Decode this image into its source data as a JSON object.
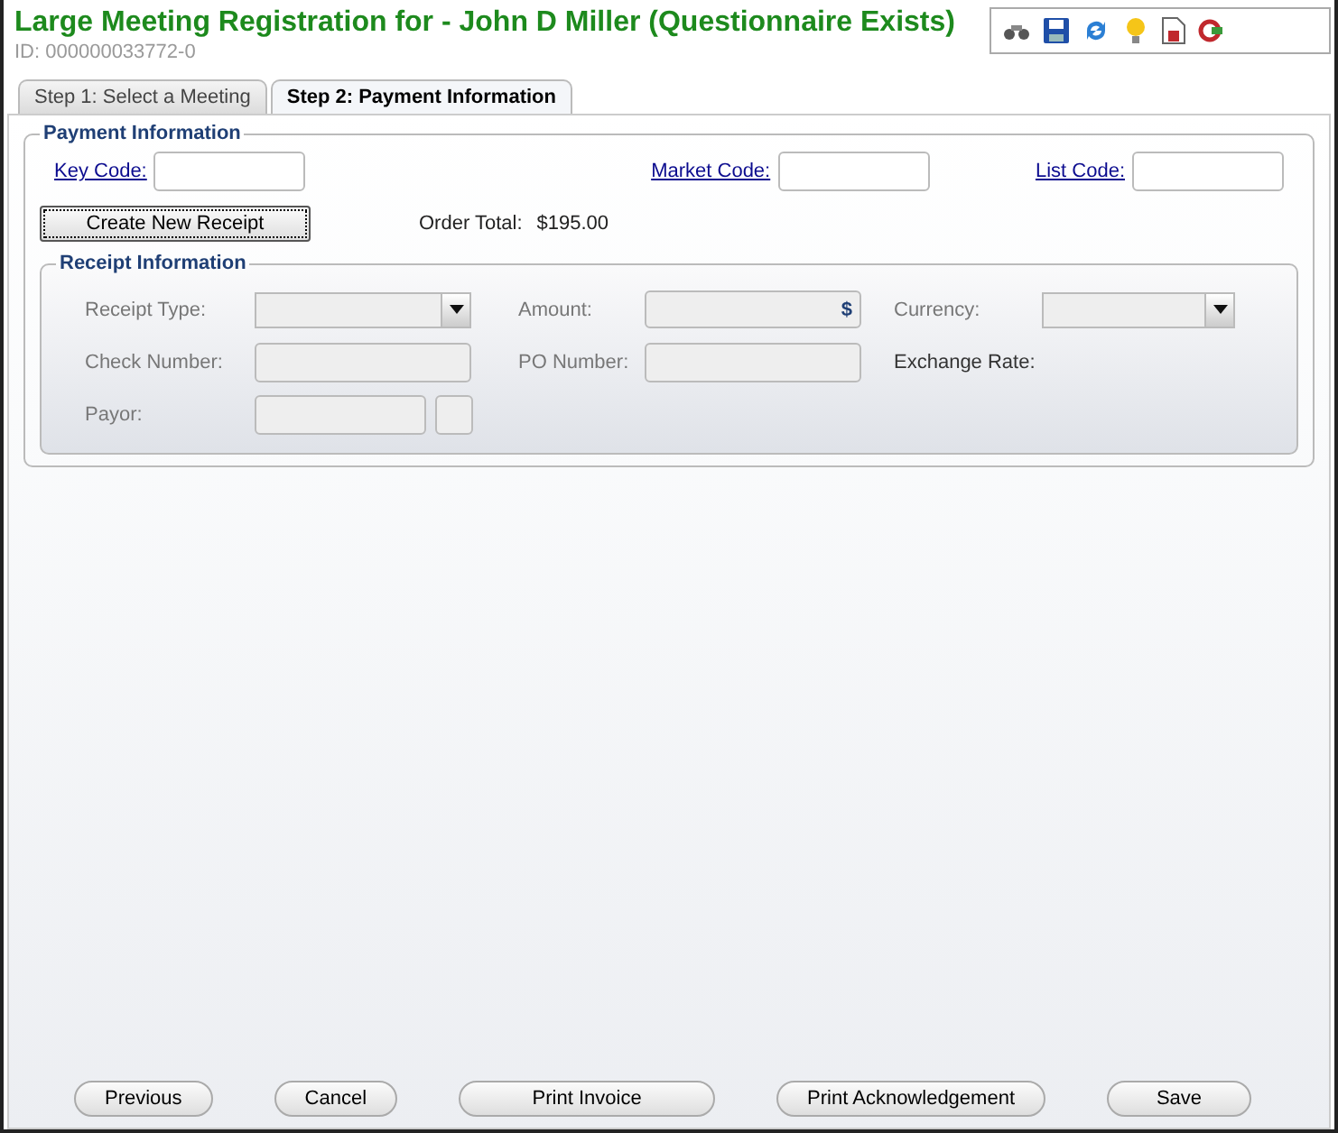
{
  "header": {
    "title": "Large Meeting Registration for - John D Miller (Questionnaire Exists)",
    "id": "ID: 000000033772-0"
  },
  "tabs": [
    {
      "label": "Step 1: Select a Meeting",
      "selected": false
    },
    {
      "label": "Step 2: Payment Information",
      "selected": true
    }
  ],
  "payment": {
    "legend": "Payment Information",
    "codes": [
      {
        "label": "Key Code:"
      },
      {
        "label": "Market Code:"
      },
      {
        "label": "List Code:"
      }
    ],
    "create_button": "Create New Receipt",
    "order_total_label": "Order Total:",
    "order_total": "$195.00"
  },
  "receipt": {
    "legend": "Receipt Information",
    "columns": [
      [
        {
          "label": "Receipt Type:",
          "kind": "select",
          "disabled": true
        },
        {
          "label": "Check Number:",
          "kind": "text",
          "disabled": true
        },
        {
          "label": "Payor:",
          "kind": "lookup",
          "disabled": true
        }
      ],
      [
        {
          "label": "Amount:",
          "kind": "amount",
          "symbol": "$",
          "disabled": true
        },
        {
          "label": "PO Number:",
          "kind": "text",
          "disabled": true
        }
      ],
      [
        {
          "label": "Currency:",
          "kind": "select",
          "disabled": true
        },
        {
          "label": "Exchange Rate:",
          "kind": "label"
        }
      ]
    ]
  },
  "buttons": [
    "Previous",
    "Cancel",
    "Print Invoice",
    "Print Acknowledgement",
    "Save"
  ]
}
